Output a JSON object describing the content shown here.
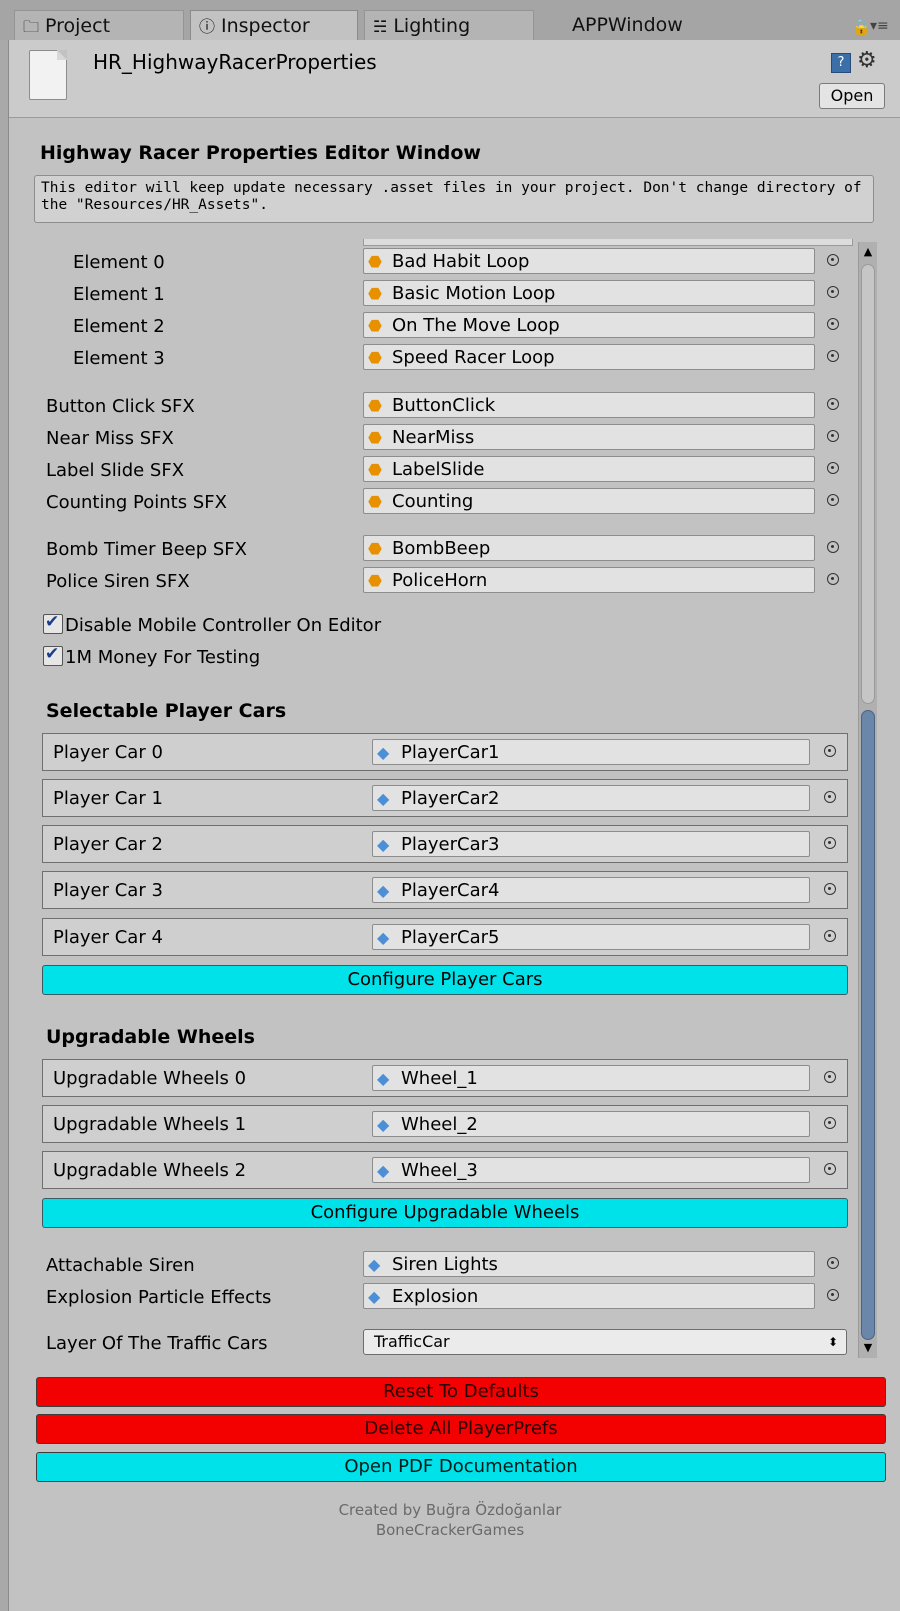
{
  "tabs": {
    "project": "Project",
    "inspector": "Inspector",
    "lighting": "Lighting",
    "appwindow": "APPWindow"
  },
  "header": {
    "asset_name": "HR_HighwayRacerProperties",
    "open_label": "Open"
  },
  "editor": {
    "title": "Highway Racer Properties Editor Window",
    "help_text": "This editor will keep update necessary .asset files in your project. Don't change directory of the \"Resources/HR_Assets\"."
  },
  "music_elements": [
    {
      "label": "Element 0",
      "value": "Bad Habit Loop"
    },
    {
      "label": "Element 1",
      "value": "Basic Motion Loop"
    },
    {
      "label": "Element 2",
      "value": "On The Move Loop"
    },
    {
      "label": "Element 3",
      "value": "Speed Racer Loop"
    }
  ],
  "sfx": [
    {
      "label": "Button Click SFX",
      "value": "ButtonClick"
    },
    {
      "label": "Near Miss SFX",
      "value": "NearMiss"
    },
    {
      "label": "Label Slide SFX",
      "value": "LabelSlide"
    },
    {
      "label": "Counting Points SFX",
      "value": "Counting"
    },
    {
      "label": "Bomb Timer Beep SFX",
      "value": "BombBeep"
    },
    {
      "label": "Police Siren SFX",
      "value": "PoliceHorn"
    }
  ],
  "toggles": {
    "disable_mobile": "Disable Mobile Controller On Editor",
    "money": "1M Money For Testing"
  },
  "player_cars": {
    "title": "Selectable Player Cars",
    "items": [
      {
        "label": "Player Car 0",
        "value": "PlayerCar1"
      },
      {
        "label": "Player Car 1",
        "value": "PlayerCar2"
      },
      {
        "label": "Player Car 2",
        "value": "PlayerCar3"
      },
      {
        "label": "Player Car 3",
        "value": "PlayerCar4"
      },
      {
        "label": "Player Car 4",
        "value": "PlayerCar5"
      }
    ],
    "configure_label": "Configure Player Cars"
  },
  "wheels": {
    "title": "Upgradable Wheels",
    "items": [
      {
        "label": "Upgradable Wheels 0",
        "value": "Wheel_1"
      },
      {
        "label": "Upgradable Wheels 1",
        "value": "Wheel_2"
      },
      {
        "label": "Upgradable Wheels 2",
        "value": "Wheel_3"
      }
    ],
    "configure_label": "Configure Upgradable Wheels"
  },
  "extras": {
    "siren_label": "Attachable Siren",
    "siren_value": "Siren Lights",
    "explosion_label": "Explosion Particle Effects",
    "explosion_value": "Explosion",
    "layer_label": "Layer Of The Traffic Cars",
    "layer_value": "TrafficCar"
  },
  "actions": {
    "reset": "Reset To Defaults",
    "delete_prefs": "Delete All PlayerPrefs",
    "open_pdf": "Open PDF Documentation"
  },
  "credits": {
    "line1": "Created by Buğra Özdoğanlar",
    "line2": "BoneCrackerGames"
  },
  "colors": {
    "cyan_button": "#00e2ea",
    "red_button": "#f30000",
    "audio_icon": "#e79100",
    "prefab_icon": "#4c8fd6"
  }
}
